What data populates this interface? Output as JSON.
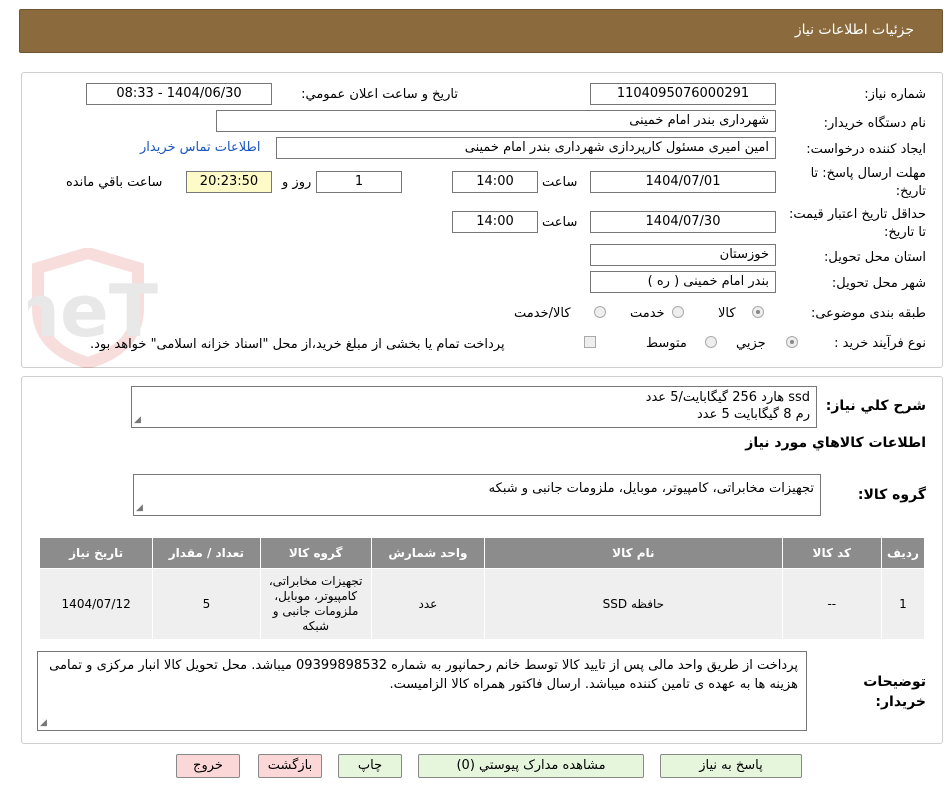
{
  "header": {
    "title": "جزئیات اطلاعات نیاز"
  },
  "form": {
    "need_number_label": "شماره نیاز:",
    "need_number": "1104095076000291",
    "announce_label": "تاریخ و ساعت اعلان عمومي:",
    "announce_value": "1404/06/30 - 08:33",
    "buyer_org_label": "نام دستگاه خريدار:",
    "buyer_org": "شهرداری بندر امام خمینی",
    "requester_label": "ايجاد کننده درخواست:",
    "requester": "امین امیری مسئول کارپردازی شهرداری بندر امام خمینی",
    "contact_link": "اطلاعات تماس خريدار",
    "deadline_label": "مهلت ارسال پاسخ: تا تاريخ:",
    "deadline_date": "1404/07/01",
    "time_label": "ساعت",
    "deadline_time": "14:00",
    "days_value": "1",
    "days_label": "روز و",
    "remaining_time": "20:23:50",
    "remaining_label": "ساعت باقي مانده",
    "validity_label": "حداقل تاريخ اعتبار قيمت: تا تاريخ:",
    "validity_date": "1404/07/30",
    "validity_time": "14:00",
    "province_label": "استان محل تحويل:",
    "province": "خوزستان",
    "city_label": "شهر محل تحويل:",
    "city": "بندر امام خمینی ( ره )",
    "category_label": "طبقه بندی موضوعی:",
    "category_options": [
      "کالا",
      "خدمت",
      "کالا/خدمت"
    ],
    "process_label": "نوع فرآيند خريد :",
    "process_options": [
      "جزيي",
      "متوسط"
    ],
    "payment_note": "پرداخت تمام يا بخشی از مبلغ خريد،از محل \"اسناد خزانه اسلامی\" خواهد بود."
  },
  "description": {
    "label": "شرح کلي نياز:",
    "line1": "ssd هارد 256 گیگابایت/5 عدد",
    "line2": "رم 8 گیگابایت  5 عدد"
  },
  "goods": {
    "section_title": "اطلاعات کالاهاي مورد نياز",
    "group_label": "گروه کالا:",
    "group_value": "تجهیزات مخابراتی، کامپیوتر، موبایل، ملزومات جانبی و شبکه",
    "columns": [
      "رديف",
      "کد کالا",
      "نام کالا",
      "واحد شمارش",
      "گروه کالا",
      "تعداد / مقدار",
      "تاريخ نياز"
    ],
    "rows": [
      {
        "row": "1",
        "code": "--",
        "name": "حافظه SSD",
        "unit": "عدد",
        "group": "تجهیزات مخابراتی، کامپیوتر، موبایل، ملزومات جانبی و شبکه",
        "qty": "5",
        "date": "1404/07/12"
      }
    ]
  },
  "notes": {
    "label": "توضيحات خريدار:",
    "text": "پرداخت از طریق واحد مالی پس از تایید کالا توسط خانم رحمانپور به شماره 09399898532 میباشد. محل تحویل کالا انبار مرکزی و تمامی هزینه ها به عهده ی تامین کننده میباشد. ارسال فاکتور همراه کالا الزامیست."
  },
  "buttons": {
    "reply": "پاسخ به نياز",
    "attachments": "مشاهده مدارک پيوستي (0)",
    "print": "چاپ",
    "back": "بازگشت",
    "exit": "خروج"
  },
  "watermark": {
    "text": "AriaTender.neT"
  },
  "colors": {
    "header": "#8b6b3e",
    "table_header": "#8c8c8c",
    "remaining_bg": "#fffbc9",
    "link": "#1a55c0"
  }
}
